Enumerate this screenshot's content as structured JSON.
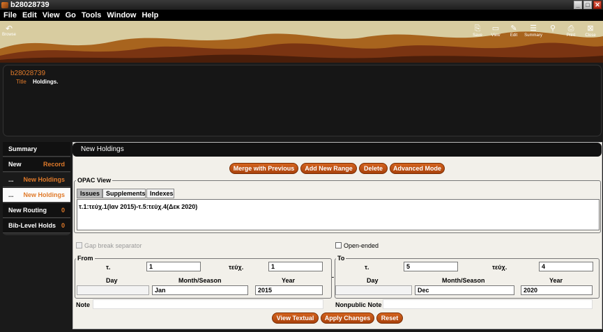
{
  "window": {
    "title": "b28028739"
  },
  "menu": [
    "File",
    "Edit",
    "View",
    "Go",
    "Tools",
    "Window",
    "Help"
  ],
  "toolbar": {
    "browse": "Browse",
    "tools": [
      "Save",
      "View",
      "Edit",
      "Summary",
      "",
      "Print",
      "Close"
    ]
  },
  "record": {
    "id": "b28028739",
    "title_label": "Title",
    "title_value": "Holdings."
  },
  "sidebar": {
    "summary": "Summary",
    "new_label": "New",
    "new_right": "Record",
    "holdings1_left": "...",
    "holdings1_right": "New Holdings",
    "holdings2_left": "...",
    "holdings2_right": "New Holdings",
    "routing": "New Routing",
    "routing_count": "0",
    "holds": "Bib-Level Holds",
    "holds_count": "0"
  },
  "panel": {
    "heading": "New Holdings",
    "buttons": [
      "Merge with Previous",
      "Add New Range",
      "Delete",
      "Advanced Mode"
    ],
    "opac_legend": "OPAC View",
    "tabs": [
      "Issues",
      "Supplements",
      "Indexes"
    ],
    "opac_text": "τ.1:τεύχ.1(Ιαν   2015)-τ.5:τεύχ.4(Δεκ   2020)",
    "gap_break": "Gap break separator",
    "open_ended": "Open-ended"
  },
  "from": {
    "legend": "From",
    "vol_label": "τ.",
    "vol_value": "1",
    "issue_label": "τεύχ.",
    "issue_value": "1",
    "day_label": "Day",
    "day_value": "",
    "month_label": "Month/Season",
    "month_value": "Jan",
    "year_label": "Year",
    "year_value": "2015"
  },
  "to": {
    "legend": "To",
    "vol_label": "τ.",
    "vol_value": "5",
    "issue_label": "τεύχ.",
    "issue_value": "4",
    "day_label": "Day",
    "day_value": "",
    "month_label": "Month/Season",
    "month_value": "Dec",
    "year_label": "Year",
    "year_value": "2020"
  },
  "notes": {
    "note_label": "Note",
    "note_value": "",
    "nonpublic_label": "Nonpublic Note",
    "nonpublic_value": ""
  },
  "footer_buttons": [
    "View Textual",
    "Apply Changes",
    "Reset"
  ],
  "colors": {
    "accent": "#e07a2a",
    "button": "#c0541a",
    "panel_bg": "#f2f0ea"
  }
}
